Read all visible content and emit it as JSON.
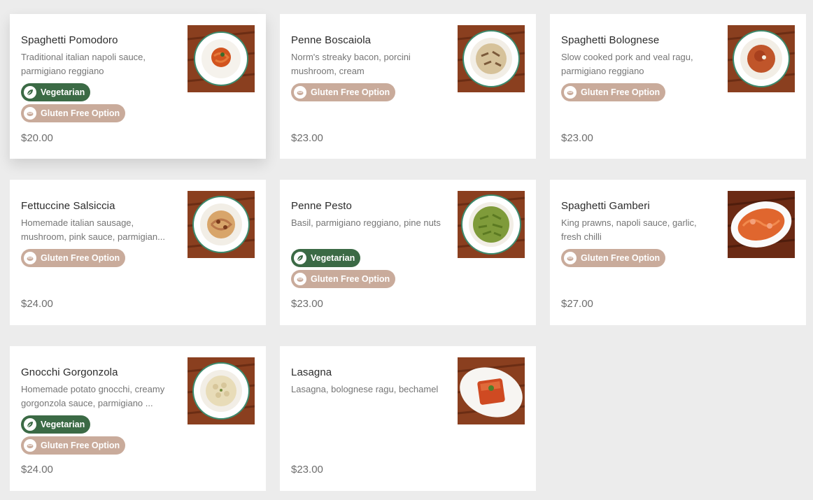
{
  "menu": {
    "items": [
      {
        "name": "Spaghetti Pomodoro",
        "description": "Traditional italian napoli sauce, parmigiano reggiano",
        "price": "$20.00",
        "badges": [
          "Vegetarian",
          "Gluten Free Option"
        ],
        "image": "spaghetti-pomodoro-photo"
      },
      {
        "name": "Penne Boscaiola",
        "description": "Norm's streaky bacon, porcini mushroom, cream",
        "price": "$23.00",
        "badges": [
          "Gluten Free Option"
        ],
        "image": "penne-boscaiola-photo"
      },
      {
        "name": "Spaghetti Bolognese",
        "description": "Slow cooked pork and veal ragu, parmigiano reggiano",
        "price": "$23.00",
        "badges": [
          "Gluten Free Option"
        ],
        "image": "spaghetti-bolognese-photo"
      },
      {
        "name": "Fettuccine Salsiccia",
        "description": "Homemade italian sausage, mushroom, pink sauce, parmigian...",
        "price": "$24.00",
        "badges": [
          "Gluten Free Option"
        ],
        "image": "fettuccine-salsiccia-photo"
      },
      {
        "name": "Penne Pesto",
        "description": "Basil, parmigiano reggiano, pine nuts",
        "price": "$23.00",
        "badges": [
          "Vegetarian",
          "Gluten Free Option"
        ],
        "image": "penne-pesto-photo"
      },
      {
        "name": "Spaghetti Gamberi",
        "description": "King prawns, napoli sauce, garlic, fresh chilli",
        "price": "$27.00",
        "badges": [
          "Gluten Free Option"
        ],
        "image": "spaghetti-gamberi-photo"
      },
      {
        "name": "Gnocchi Gorgonzola",
        "description": "Homemade potato gnocchi, creamy gorgonzola sauce, parmigiano ...",
        "price": "$24.00",
        "badges": [
          "Vegetarian",
          "Gluten Free Option"
        ],
        "image": "gnocchi-gorgonzola-photo"
      },
      {
        "name": "Lasagna",
        "description": "Lasagna, bolognese ragu, bechamel",
        "price": "$23.00",
        "badges": [],
        "image": "lasagna-photo"
      }
    ]
  },
  "badge_colors": {
    "Vegetarian": "#3b6a45",
    "Gluten Free Option": "#c9ab9b"
  },
  "icons": {
    "Vegetarian": "leaf-icon",
    "Gluten Free Option": "wheat-icon"
  }
}
